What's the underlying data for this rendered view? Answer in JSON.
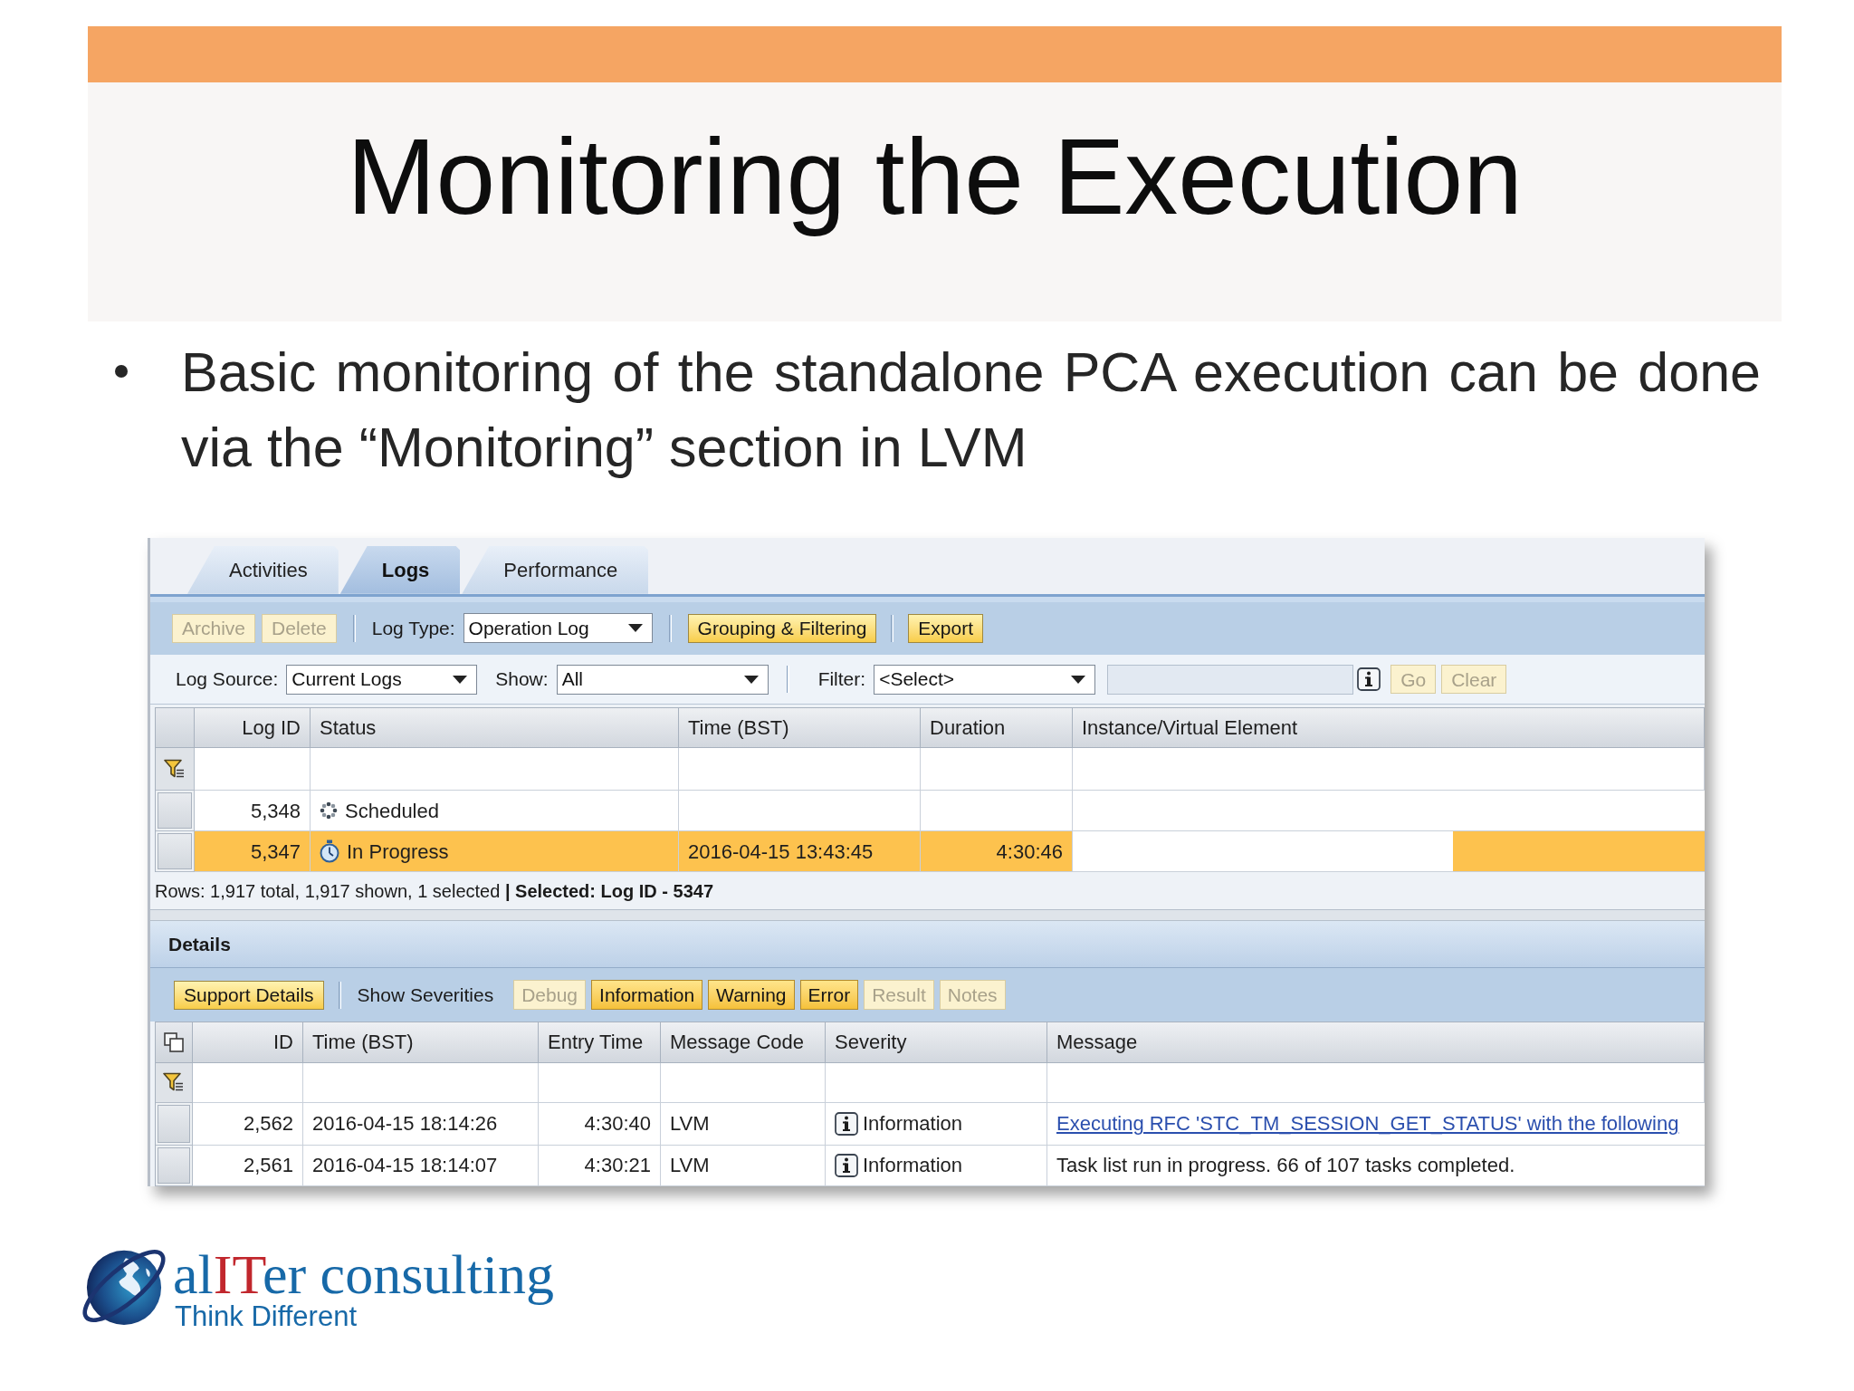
{
  "slide": {
    "title": "Monitoring the Execution",
    "bullets": [
      "Basic monitoring of the standalone PCA execution can be done via the “Monitoring” section in LVM"
    ]
  },
  "app": {
    "tabs": [
      {
        "label": "Activities",
        "selected": false
      },
      {
        "label": "Logs",
        "selected": true
      },
      {
        "label": "Performance",
        "selected": false
      }
    ],
    "toolbar": {
      "buttons": [
        {
          "label": "Archive",
          "disabled": true
        },
        {
          "label": "Delete",
          "disabled": true
        }
      ],
      "log_type": {
        "label": "Log Type:",
        "value": "Operation Log"
      },
      "grouping": {
        "label": "Grouping & Filtering",
        "disabled": false
      },
      "export": {
        "label": "Export",
        "disabled": false
      }
    },
    "filter_bar": {
      "log_source": {
        "label": "Log Source:",
        "value": "Current Logs"
      },
      "show": {
        "label": "Show:",
        "value": "All"
      },
      "filter": {
        "label": "Filter:",
        "value": "<Select>"
      },
      "buttons": [
        {
          "label": "Go",
          "disabled": true
        },
        {
          "label": "Clear",
          "disabled": true
        }
      ]
    },
    "logs_table": {
      "columns": [
        "Log ID",
        "Status",
        "Time (BST)",
        "Duration",
        "Instance/Virtual Element"
      ],
      "rows": [
        {
          "log_id": "5,348",
          "status": "Scheduled",
          "kind": "scheduled",
          "selected": false
        },
        {
          "log_id": "5,347",
          "status": "In Progress",
          "kind": "running",
          "time": "2016-04-15 13:43:45",
          "duration": "4:30:46",
          "selected": true
        }
      ]
    },
    "status_bar": "Rows: 1,917 total, 1,917 shown, 1 selected **| Selected: Log ID - 5347**",
    "details": {
      "title": "Details",
      "support_button": {
        "label": "Support Details",
        "disabled": false
      },
      "severities_label": "Show Severities",
      "severities": [
        {
          "label": "Debug",
          "selected": false
        },
        {
          "label": "Information",
          "selected": true
        },
        {
          "label": "Warning",
          "selected": true
        },
        {
          "label": "Error",
          "selected": true
        },
        {
          "label": "Result",
          "selected": false
        },
        {
          "label": "Notes",
          "selected": false
        }
      ],
      "table": {
        "columns": [
          "ID",
          "Time (BST)",
          "Entry Time",
          "Message Code",
          "Severity",
          "Message"
        ],
        "rows": [
          {
            "id": "2,562",
            "time": "2016-04-15 18:14:26",
            "entry_time": "4:30:40",
            "code": "LVM",
            "severity": "Information",
            "message": "Executing RFC 'STC_TM_SESSION_GET_STATUS' with the following",
            "link": true
          },
          {
            "id": "2,561",
            "time": "2016-04-15 18:14:07",
            "entry_time": "4:30:21",
            "code": "LVM",
            "severity": "Information",
            "message": "Task list run in progress. 66 of 107 tasks completed.",
            "link": false
          }
        ]
      }
    }
  },
  "logo": {
    "wordmark": [
      "al",
      "IT",
      "er consulting"
    ],
    "tagline": "Think Different"
  }
}
